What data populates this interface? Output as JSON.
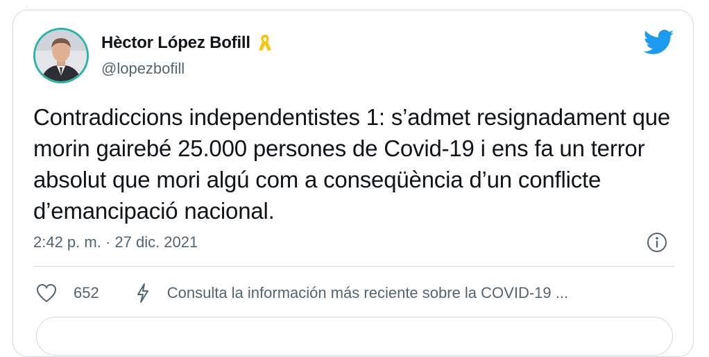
{
  "author": {
    "name": "Hèctor López Bofill",
    "handle": "@lopezbofill",
    "badge_icon": "yellow-ribbon-icon",
    "avatar_ring_color": "#2bb3a4"
  },
  "brand": {
    "icon": "twitter-bird-icon",
    "color": "#1d9bf0"
  },
  "tweet": {
    "text": "Contradiccions independentistes 1: s’admet resignadament que morin gairebé 25.000 persones de Covid-19 i ens fa un terror absolut que mori algú com a conseqüència d’un conflicte d’emancipació nacional.",
    "timestamp": "2:42 p. m. · 27 dic. 2021"
  },
  "actions": {
    "like_count": "652",
    "covid_notice": "Consulta la información más reciente sobre la COVID-19 ..."
  },
  "colors": {
    "secondary_text": "#536471",
    "border": "#cfd9de",
    "ribbon": "#f5c518"
  }
}
